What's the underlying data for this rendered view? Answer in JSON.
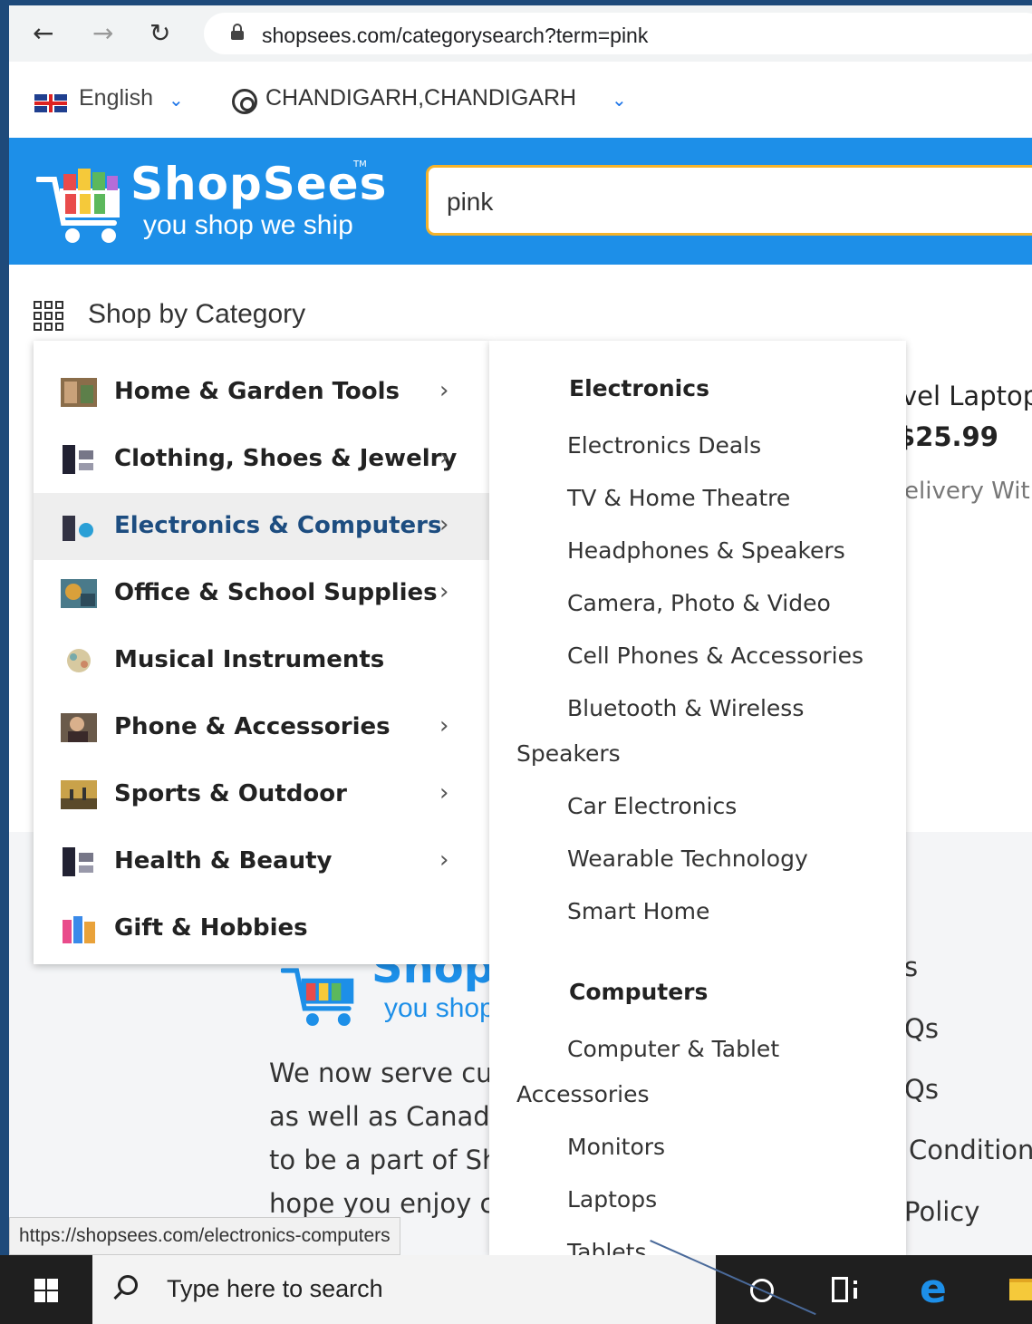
{
  "browser": {
    "url": "shopsees.com/categorysearch?term=pink"
  },
  "topbar": {
    "language": "English",
    "location": "CHANDIGARH,CHANDIGARH"
  },
  "header": {
    "brand": "ShopSees",
    "tm": "TM",
    "tagline": "you shop we ship",
    "search_value": "pink"
  },
  "shop_by_category": "Shop by Category",
  "menu": {
    "items": [
      {
        "label": "Home & Garden Tools",
        "has_arrow": true
      },
      {
        "label": "Clothing, Shoes & Jewelry",
        "has_arrow": true
      },
      {
        "label": "Electronics & Computers",
        "has_arrow": true,
        "active": true
      },
      {
        "label": "Office & School Supplies",
        "has_arrow": true
      },
      {
        "label": "Musical Instruments",
        "has_arrow": false
      },
      {
        "label": "Phone & Accessories",
        "has_arrow": true
      },
      {
        "label": "Sports & Outdoor",
        "has_arrow": true
      },
      {
        "label": "Health & Beauty",
        "has_arrow": true
      },
      {
        "label": "Gift & Hobbies",
        "has_arrow": false
      }
    ],
    "arrow": "›"
  },
  "submenu": {
    "electronics_heading": "Electronics",
    "electronics": [
      "Electronics Deals",
      "TV & Home Theatre",
      "Headphones & Speakers",
      "Camera, Photo & Video",
      "Cell Phones & Accessories",
      "Bluetooth & Wireless",
      "Speakers",
      "Car Electronics",
      "Wearable Technology",
      "Smart Home"
    ],
    "computers_heading": "Computers",
    "computers": [
      "Computer & Tablet",
      "Accessories",
      "Monitors",
      "Laptops",
      "Tablets"
    ]
  },
  "background_product": {
    "title": "vel Laptop",
    "price": "$25.99",
    "delivery": "elivery With"
  },
  "footer": {
    "brand": "Shop",
    "tagline": "you shop",
    "text_lines": [
      "We now serve cu",
      "as well as Canad",
      "to be a part of Sh",
      "hope you enjoy c"
    ],
    "links": [
      "s",
      "Qs",
      "Qs",
      "Condition",
      "Policy"
    ]
  },
  "status_url": "https://shopsees.com/electronics-computers",
  "taskbar": {
    "search_placeholder": "Type here to search"
  },
  "colors": {
    "brand_blue": "#1d8fe8",
    "search_border": "#f5b32a",
    "active_menu_text": "#1d4d80"
  }
}
